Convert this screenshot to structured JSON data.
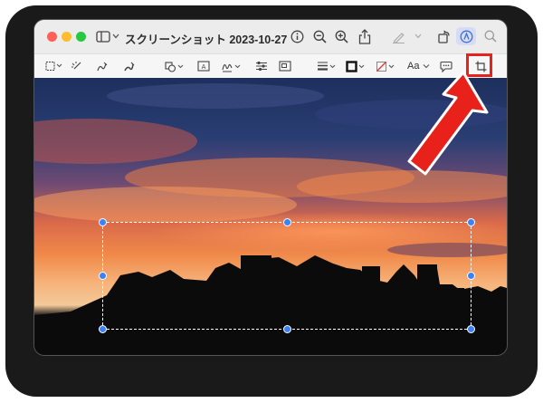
{
  "window": {
    "title": "スクリーンショット 2023-10-27 1..."
  },
  "titlebar_icons": [
    "sidebar-icon",
    "chevron-down-icon",
    "info-icon",
    "zoom-out-icon",
    "zoom-in-icon",
    "share-icon",
    "highlight-pen-icon",
    "chevron-down-icon",
    "rotate-icon",
    "markup-icon",
    "search-icon"
  ],
  "toolbar_tools": [
    "rectangular-selection-icon",
    "instant-alpha-icon",
    "sketch-icon",
    "draw-icon",
    "shapes-icon",
    "text-box-icon",
    "sign-icon",
    "adjust-color-icon",
    "adjust-size-icon",
    "shape-style-icon",
    "border-color-icon",
    "fill-color-icon",
    "text-style-icon",
    "description-icon",
    "crop-icon"
  ],
  "text_style_label": "Aa",
  "colors": {
    "accent": "#3b82f6",
    "annotation_red": "#e8221b",
    "markup_active_bg": "#d7dcf5"
  }
}
